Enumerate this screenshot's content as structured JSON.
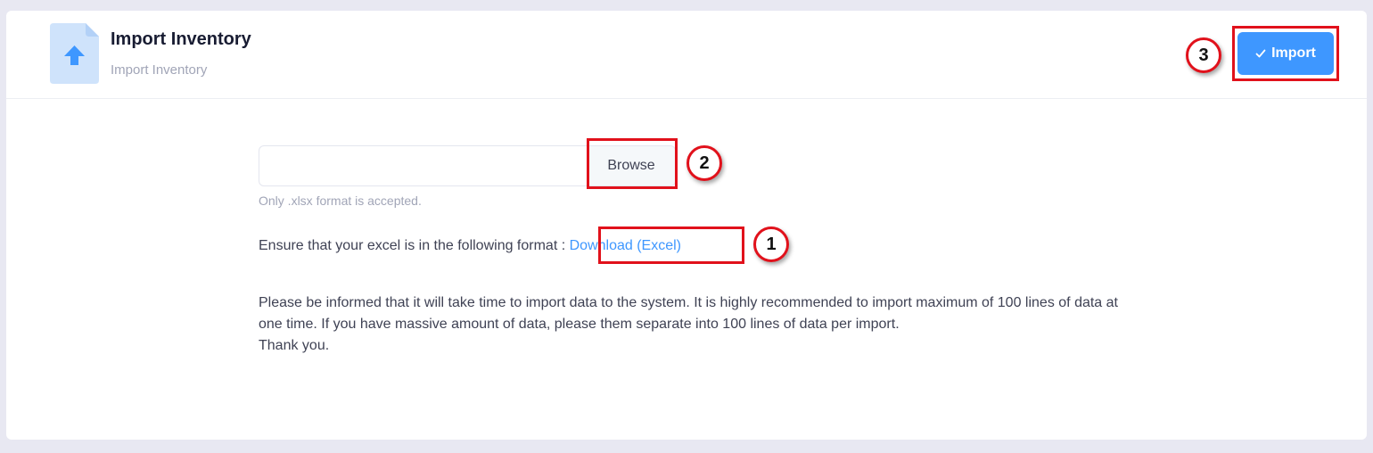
{
  "header": {
    "title": "Import Inventory",
    "subtitle": "Import Inventory",
    "import_button": "Import",
    "icon": "file-upload-icon"
  },
  "upload": {
    "file_value": "",
    "browse_label": "Browse",
    "hint": "Only .xlsx format is accepted."
  },
  "format": {
    "text": "Ensure that your excel is in the following format : ",
    "link": "Download (Excel)"
  },
  "info": {
    "paragraph": "Please be informed that it will take time to import data to the system. It is highly recommended to import maximum of 100 lines of data at one time. If you have massive amount of data, please them separate into 100 lines of data per import.",
    "thanks": "Thank you."
  },
  "annotations": {
    "one": "1",
    "two": "2",
    "three": "3"
  },
  "colors": {
    "primary": "#3e97ff",
    "annotation": "#e1111b",
    "background": "#e8e8f2"
  }
}
